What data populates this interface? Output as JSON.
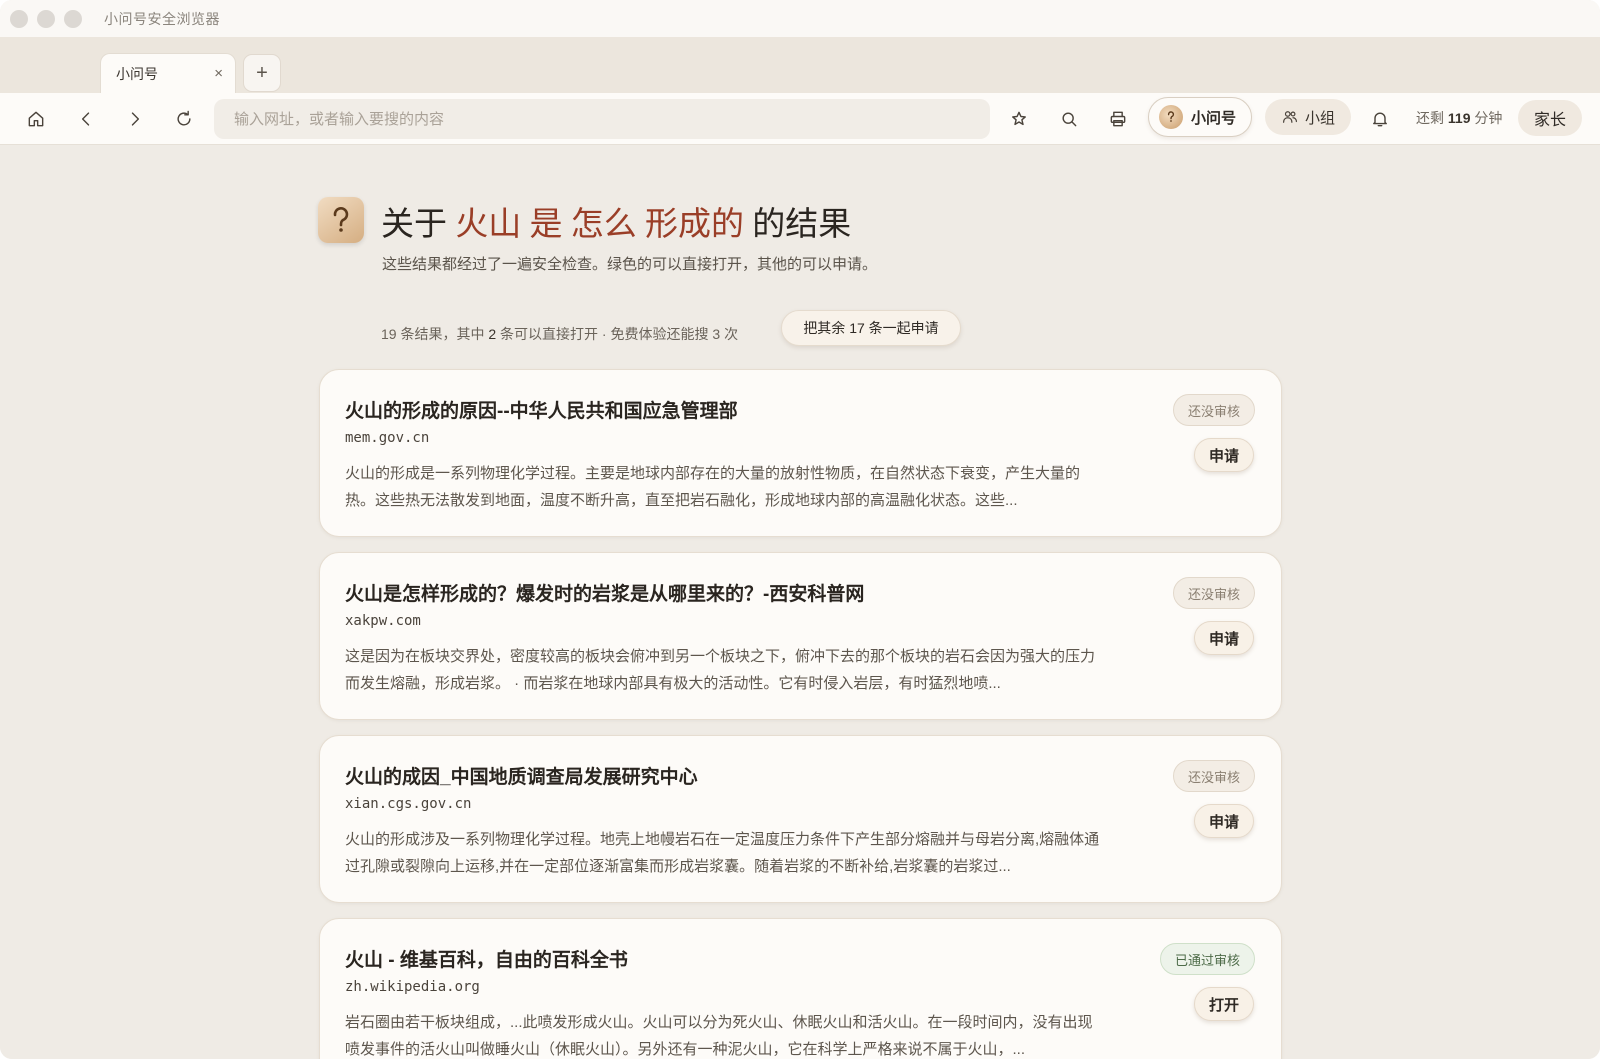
{
  "window": {
    "app_title": "小问号安全浏览器"
  },
  "tabs": [
    {
      "label": "小问号",
      "close": "×"
    }
  ],
  "new_tab_label": "+",
  "toolbar": {
    "address_placeholder": "输入网址，或者输入要搜的内容",
    "profile_label": "小问号",
    "group_label": "小组",
    "timer_prefix": "还剩",
    "timer_minutes": "119",
    "timer_suffix": "分钟",
    "parent_label": "家长"
  },
  "header": {
    "prefix": "关于",
    "query_words": [
      "火山",
      "是",
      "怎么",
      "形成的"
    ],
    "suffix": "的结果",
    "subtitle": "这些结果都经过了一遍安全检查。绿色的可以直接打开，其他的可以申请。"
  },
  "stats": {
    "total": "19",
    "total_text": "条结果，其中",
    "openable": "2",
    "openable_text": "条可以直接打开 · 免费体验还能搜",
    "remaining_searches": "3",
    "remaining_text": "次",
    "apply_all_label": "把其余 17 条一起申请"
  },
  "results": [
    {
      "title": "火山的形成的原因--中华人民共和国应急管理部",
      "domain": "mem.gov.cn",
      "snippet": "火山的形成是一系列物理化学过程。主要是地球内部存在的大量的放射性物质，在自然状态下衰变，产生大量的热。这些热无法散发到地面，温度不断升高，直至把岩石融化，形成地球内部的高温融化状态。这些...",
      "status": "还没审核",
      "status_type": "pending",
      "action": "申请"
    },
    {
      "title": "火山是怎样形成的？爆发时的岩浆是从哪里来的？-西安科普网",
      "domain": "xakpw.com",
      "snippet": "这是因为在板块交界处，密度较高的板块会俯冲到另一个板块之下，俯冲下去的那个板块的岩石会因为强大的压力而发生熔融，形成岩浆。 · 而岩浆在地球内部具有极大的活动性。它有时侵入岩层，有时猛烈地喷...",
      "status": "还没审核",
      "status_type": "pending",
      "action": "申请"
    },
    {
      "title": "火山的成因_中国地质调查局发展研究中心",
      "domain": "xian.cgs.gov.cn",
      "snippet": "火山的形成涉及一系列物理化学过程。地壳上地幔岩石在一定温度压力条件下产生部分熔融并与母岩分离,熔融体通过孔隙或裂隙向上运移,并在一定部位逐渐富集而形成岩浆囊。随着岩浆的不断补给,岩浆囊的岩浆过...",
      "status": "还没审核",
      "status_type": "pending",
      "action": "申请"
    },
    {
      "title": "火山 - 维基百科，自由的百科全书",
      "domain": "zh.wikipedia.org",
      "snippet": "岩石圈由若干板块组成，...此喷发形成火山。火山可以分为死火山、休眠火山和活火山。在一段时间内，没有出现喷发事件的活火山叫做睡火山（休眠火山）。另外还有一种泥火山，它在科学上严格来说不属于火山，...",
      "status": "已通过审核",
      "status_type": "approved",
      "action": "打开"
    }
  ],
  "colors": {
    "accent_query": "#9a3e27",
    "page_bg": "#efebe5",
    "card_bg": "#fdfbf8",
    "approved_green": "#4d6b48"
  }
}
